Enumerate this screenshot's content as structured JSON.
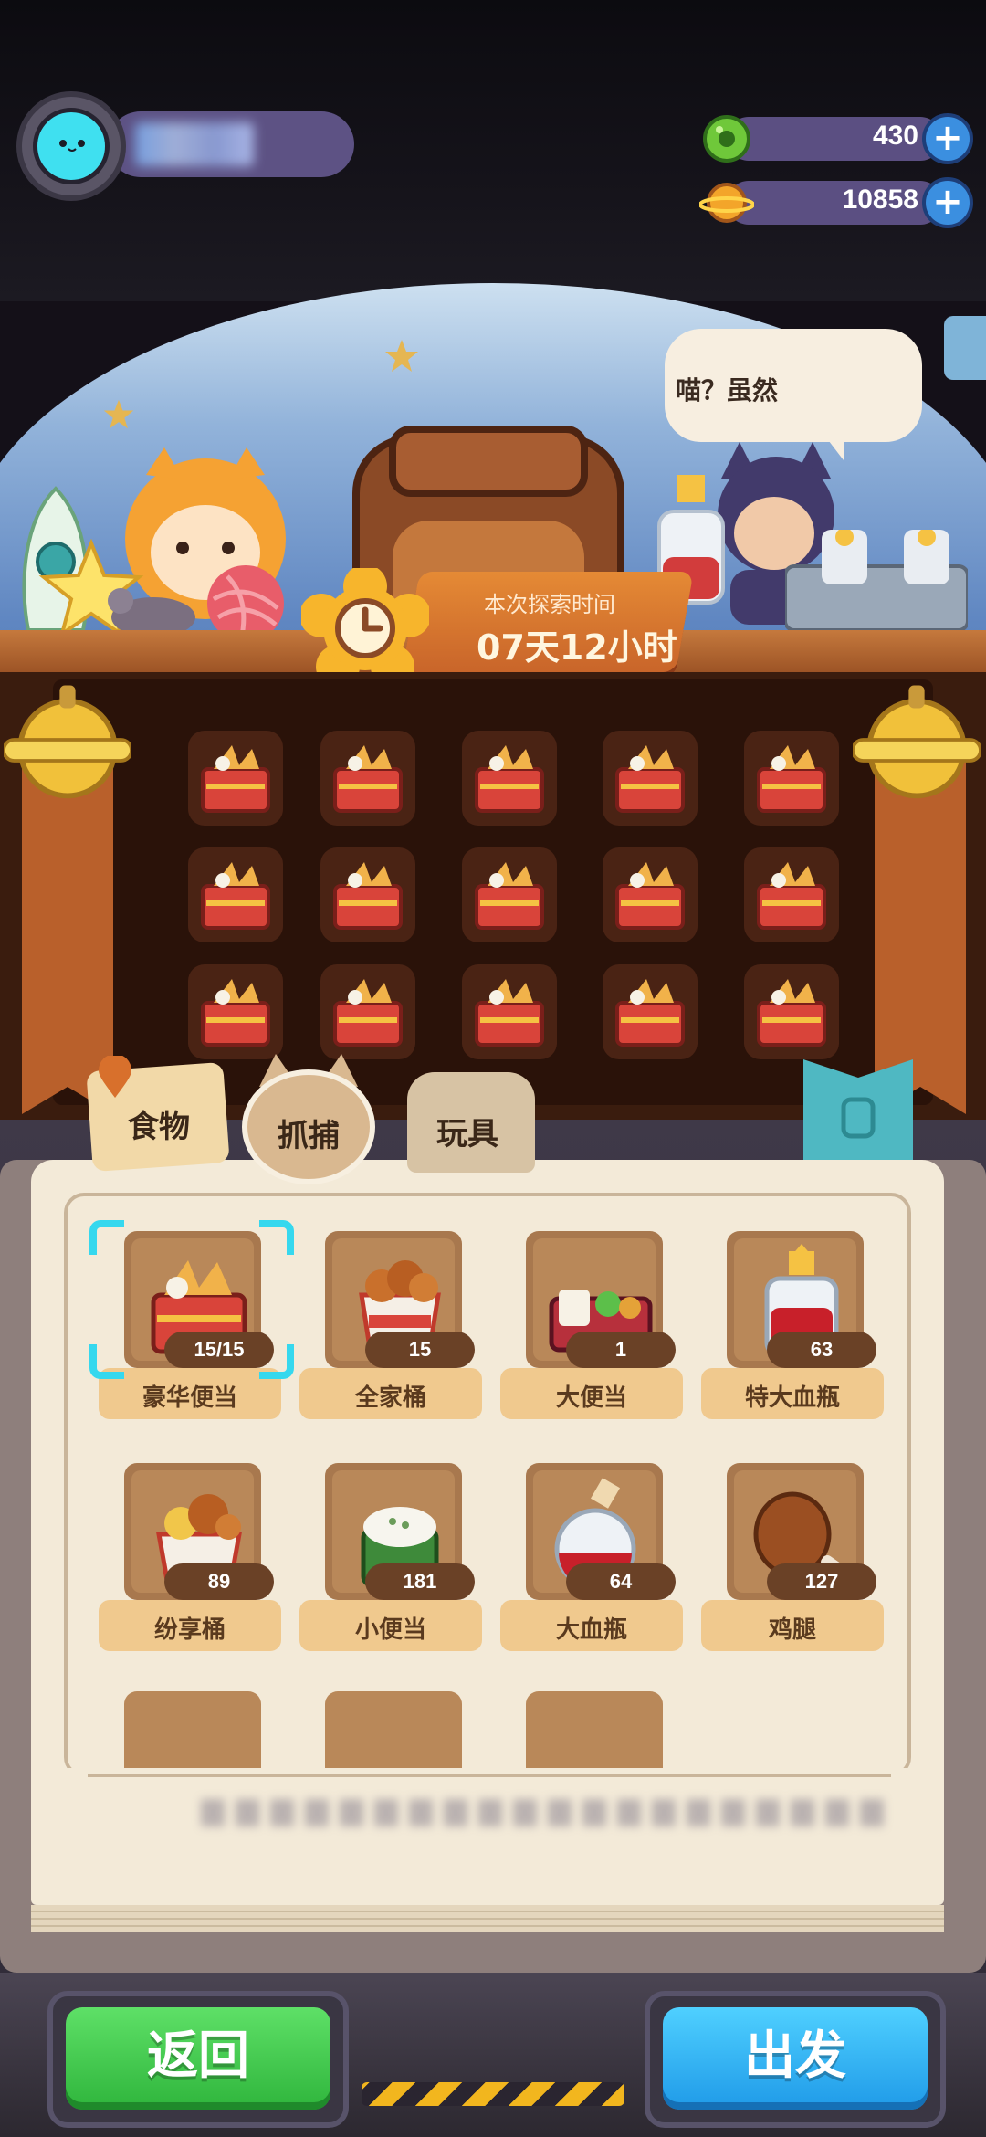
{
  "hud": {
    "gems": {
      "value": "430",
      "icon": "donut-gem-icon"
    },
    "coins": {
      "value": "10858",
      "icon": "planet-coin-icon"
    },
    "plus_label": "+"
  },
  "scene": {
    "speech": "喵？虽然",
    "timer_label": "本次探索时间",
    "timer_value": "07天12小时"
  },
  "tabs": [
    {
      "label": "食物",
      "active": true
    },
    {
      "label": "抓捕",
      "active": false
    },
    {
      "label": "玩具",
      "active": false
    }
  ],
  "items": [
    {
      "name": "豪华便当",
      "count": "15/15",
      "icon": "deluxe-bento-icon",
      "selected": true
    },
    {
      "name": "全家桶",
      "count": "15",
      "icon": "family-bucket-icon"
    },
    {
      "name": "大便当",
      "count": "1",
      "icon": "big-bento-icon"
    },
    {
      "name": "特大血瓶",
      "count": "63",
      "icon": "huge-potion-icon"
    },
    {
      "name": "纷享桶",
      "count": "89",
      "icon": "share-bucket-icon"
    },
    {
      "name": "小便当",
      "count": "181",
      "icon": "small-bento-icon"
    },
    {
      "name": "大血瓶",
      "count": "64",
      "icon": "big-potion-icon"
    },
    {
      "name": "鸡腿",
      "count": "127",
      "icon": "drumstick-icon"
    }
  ],
  "buttons": {
    "back": "返回",
    "go": "出发"
  },
  "colors": {
    "accent_select": "#36d8ee",
    "back_green": "#2fb53c",
    "go_blue": "#1f9ae8"
  }
}
